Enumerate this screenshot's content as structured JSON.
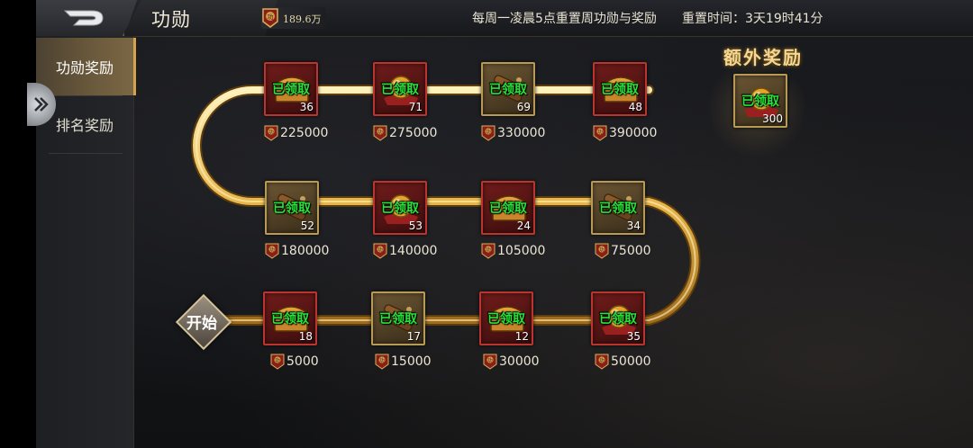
{
  "header": {
    "title": "功勋",
    "currency_value": "189.6万",
    "notice": "每周一凌晨5点重置周功勋与奖励",
    "reset_label": "重置时间：3天19时41分"
  },
  "sidebar": {
    "tabs": [
      {
        "label": "功勋奖励",
        "active": true
      },
      {
        "label": "排名奖励",
        "active": false
      }
    ]
  },
  "path": {
    "start_label": "开始"
  },
  "merit_icon_char": "功",
  "rewards": [
    {
      "item": "chest",
      "status": "已领取",
      "count": "18",
      "threshold": "5000"
    },
    {
      "item": "scroll",
      "status": "已领取",
      "count": "17",
      "threshold": "15000"
    },
    {
      "item": "chest",
      "status": "已领取",
      "count": "12",
      "threshold": "30000"
    },
    {
      "item": "orb",
      "status": "已领取",
      "count": "35",
      "threshold": "50000"
    },
    {
      "item": "scroll",
      "status": "已领取",
      "count": "34",
      "threshold": "75000"
    },
    {
      "item": "chest",
      "status": "已领取",
      "count": "24",
      "threshold": "105000"
    },
    {
      "item": "orb",
      "status": "已领取",
      "count": "53",
      "threshold": "140000"
    },
    {
      "item": "scroll",
      "status": "已领取",
      "count": "52",
      "threshold": "180000"
    },
    {
      "item": "chest",
      "status": "已领取",
      "count": "36",
      "threshold": "225000"
    },
    {
      "item": "orb",
      "status": "已领取",
      "count": "71",
      "threshold": "275000"
    },
    {
      "item": "scroll",
      "status": "已领取",
      "count": "69",
      "threshold": "330000"
    },
    {
      "item": "chest",
      "status": "已领取",
      "count": "48",
      "threshold": "390000"
    }
  ],
  "extra": {
    "title": "额外奖励",
    "item": "orb",
    "status": "已领取",
    "count": "300"
  }
}
